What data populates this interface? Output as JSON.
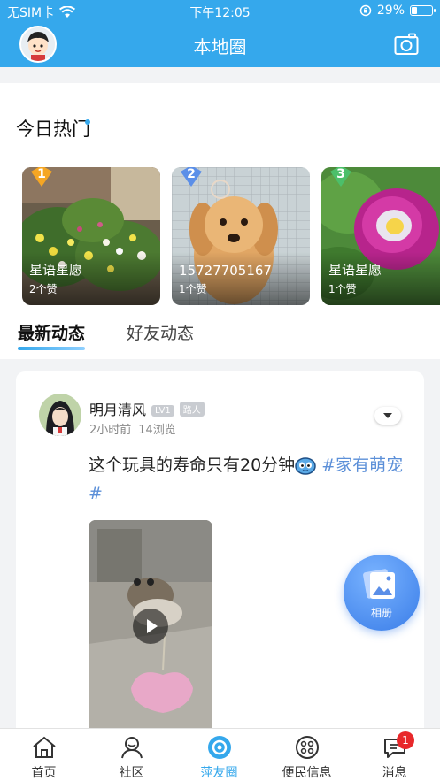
{
  "status_bar": {
    "carrier": "无SIM卡",
    "time": "下午12:05",
    "battery": "29%",
    "battery_level": 0.29
  },
  "header": {
    "title": "本地圈",
    "left_icon": "avatar",
    "right_icon": "camera-icon"
  },
  "hot_section": {
    "title": "今日热门",
    "cards": [
      {
        "rank": "1",
        "name": "星语星愿",
        "likes": "2个赞",
        "badge_color": "#f5a623"
      },
      {
        "rank": "2",
        "name": "15727705167",
        "likes": "1个赞",
        "badge_color": "#5b8fe8"
      },
      {
        "rank": "3",
        "name": "星语星愿",
        "likes": "1个赞",
        "badge_color": "#4cbf6a"
      }
    ]
  },
  "tabs": {
    "active": "最新动态",
    "inactive": "好友动态"
  },
  "post": {
    "user_name": "明月清风",
    "level_badge": "LV1",
    "role_badge": "路人",
    "time_ago": "2小时前",
    "views": "14浏览",
    "text": "这个玩具的寿命只有20分钟",
    "hashtag": "#家有萌宠#"
  },
  "album_button": {
    "label": "相册"
  },
  "bottom_nav": [
    {
      "label": "首页",
      "icon": "home-icon"
    },
    {
      "label": "社区",
      "icon": "community-icon"
    },
    {
      "label": "萍友圈",
      "icon": "circle-icon",
      "active": true
    },
    {
      "label": "便民信息",
      "icon": "info-icon"
    },
    {
      "label": "消息",
      "icon": "message-icon",
      "badge": "1"
    }
  ],
  "colors": {
    "brand": "#35a8ec",
    "tag": "#5b8fd8",
    "badge_red": "#e8282b"
  }
}
